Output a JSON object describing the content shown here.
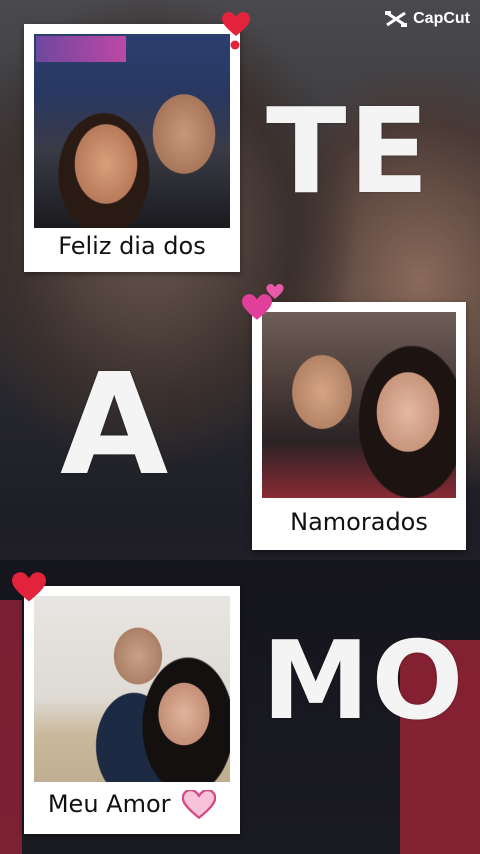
{
  "brand": {
    "name": "CapCut"
  },
  "captions": {
    "photo1": "Feliz dia dos",
    "photo2": "Namorados",
    "photo3": "Meu Amor"
  },
  "big_words": {
    "word1": "TE",
    "word2": "A",
    "word3": "MO"
  },
  "colors": {
    "heart_red": "#e3233b",
    "heart_pink": "#e0409a",
    "polaroid": "#ffffff"
  }
}
